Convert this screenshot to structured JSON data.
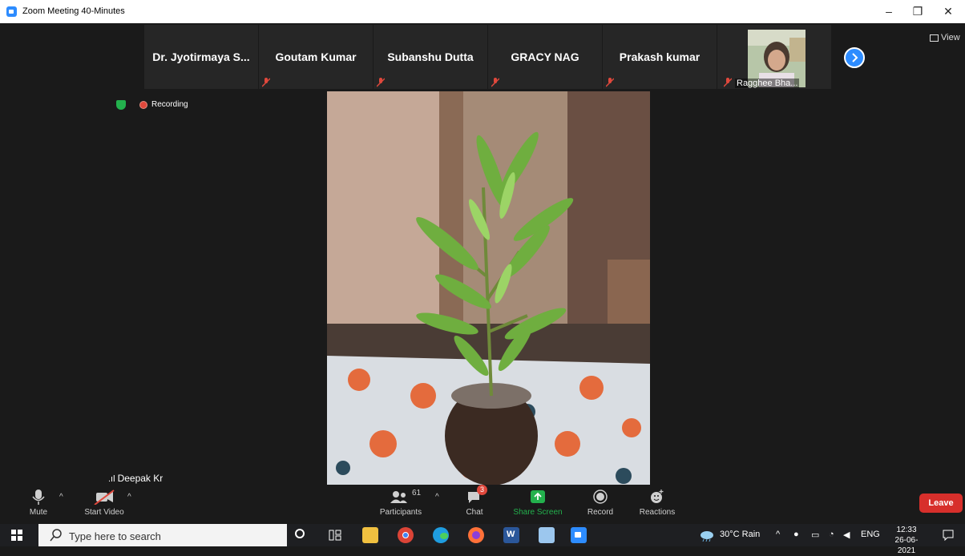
{
  "window": {
    "title": "Zoom Meeting 40-Minutes"
  },
  "participants_strip": [
    {
      "name": "Dr. Jyotirmaya S...",
      "muted": false
    },
    {
      "name": "Goutam Kumar",
      "muted": true
    },
    {
      "name": "Subanshu Dutta",
      "muted": true
    },
    {
      "name": "GRACY NAG",
      "muted": true
    },
    {
      "name": "Prakash kumar",
      "muted": true
    },
    {
      "name": "Ragghee Bha...",
      "muted": true
    }
  ],
  "view_label": "View",
  "recording_label": "Recording",
  "speaker_name": "Deepak Kr",
  "toolbar": {
    "mute": "Mute",
    "start_video": "Start Video",
    "participants": "Participants",
    "participant_count": "61",
    "chat": "Chat",
    "chat_badge": "3",
    "share_screen": "Share Screen",
    "record": "Record",
    "reactions": "Reactions",
    "leave": "Leave"
  },
  "taskbar": {
    "search_placeholder": "Type here to search",
    "weather": "30°C  Rain",
    "language": "ENG",
    "time": "12:33",
    "date": "26-06-2021"
  },
  "colors": {
    "zoom_blue": "#2d8cff",
    "leave_red": "#d72f2b",
    "share_green": "#23b14d"
  }
}
